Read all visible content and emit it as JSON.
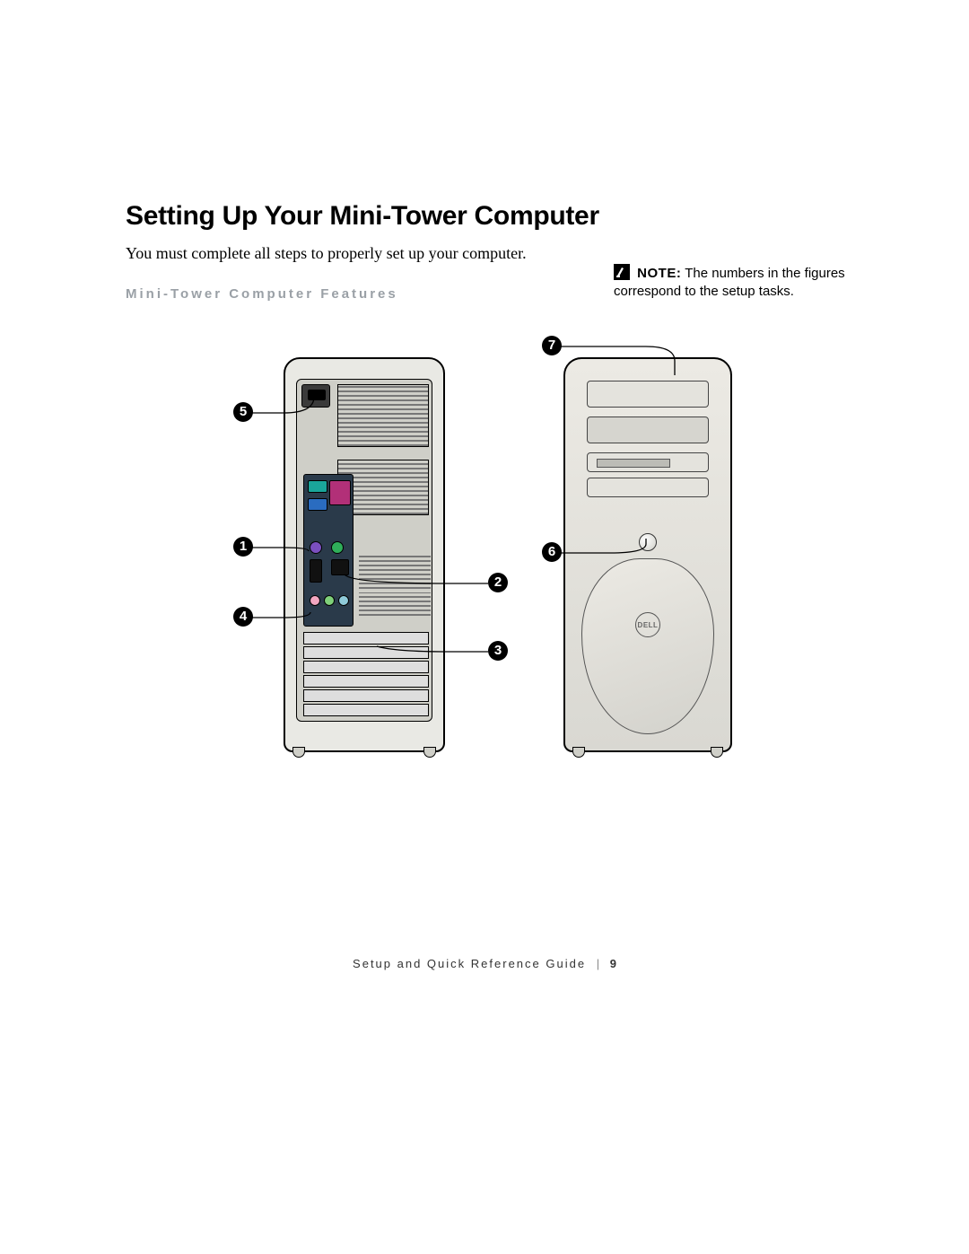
{
  "title": "Setting Up Your Mini-Tower Computer",
  "intro": "You must complete all steps to properly set up your computer.",
  "subhead": "Mini-Tower Computer Features",
  "note": {
    "label": "NOTE:",
    "text": "The numbers in the figures correspond to the setup tasks."
  },
  "callouts": {
    "c1": "1",
    "c2": "2",
    "c3": "3",
    "c4": "4",
    "c5": "5",
    "c6": "6",
    "c7": "7"
  },
  "logo": "DELL",
  "footer": {
    "book": "Setup and Quick Reference Guide",
    "sep": "|",
    "page": "9"
  }
}
